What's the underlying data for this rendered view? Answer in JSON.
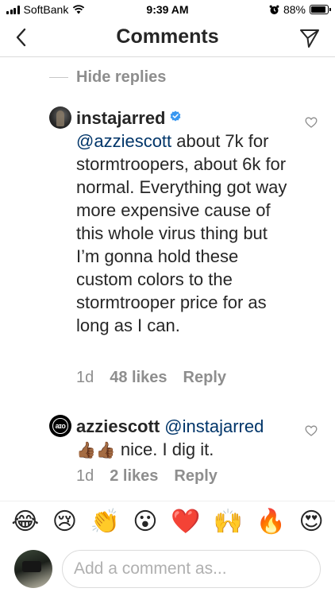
{
  "status_bar": {
    "carrier": "SoftBank",
    "time": "9:39 AM",
    "battery": "88%",
    "battery_level": 0.88
  },
  "nav": {
    "title": "Comments"
  },
  "thread": {
    "hide_replies_label": "Hide replies"
  },
  "comments": [
    {
      "username": "instajarred",
      "verified": true,
      "mention": "@azziescott",
      "text": " about 7k for stormtroopers,  about 6k for normal. Everything got way more expensive cause of this whole virus thing but I’m gonna hold these custom colors to the stormtrooper price for as long as I can.",
      "age": "1d",
      "likes": "48 likes",
      "reply_label": "Reply"
    },
    {
      "username": "azziescott",
      "mention": "@instajarred",
      "emoji_prefix": "👍🏾👍🏾",
      "text": " nice. I dig it.",
      "age": "1d",
      "likes": "2 likes",
      "reply_label": "Reply",
      "avatar_text": "aɪo"
    }
  ],
  "emoji_bar": [
    "😂",
    "😢",
    "👏",
    "😮",
    "❤️",
    "🙌",
    "🔥",
    "😍"
  ],
  "input": {
    "placeholder": "Add a comment as..."
  },
  "icons": {
    "back": "chevron-left-icon",
    "send": "paper-plane-icon",
    "like": "heart-outline-icon",
    "verified": "verified-badge-icon",
    "alarm": "alarm-clock-icon",
    "wifi": "wifi-icon",
    "battery": "battery-icon",
    "signal": "signal-bars-icon"
  },
  "colors": {
    "mention": "#003569",
    "verified": "#3897f0",
    "muted": "#8e8e8e",
    "text": "#262626"
  }
}
